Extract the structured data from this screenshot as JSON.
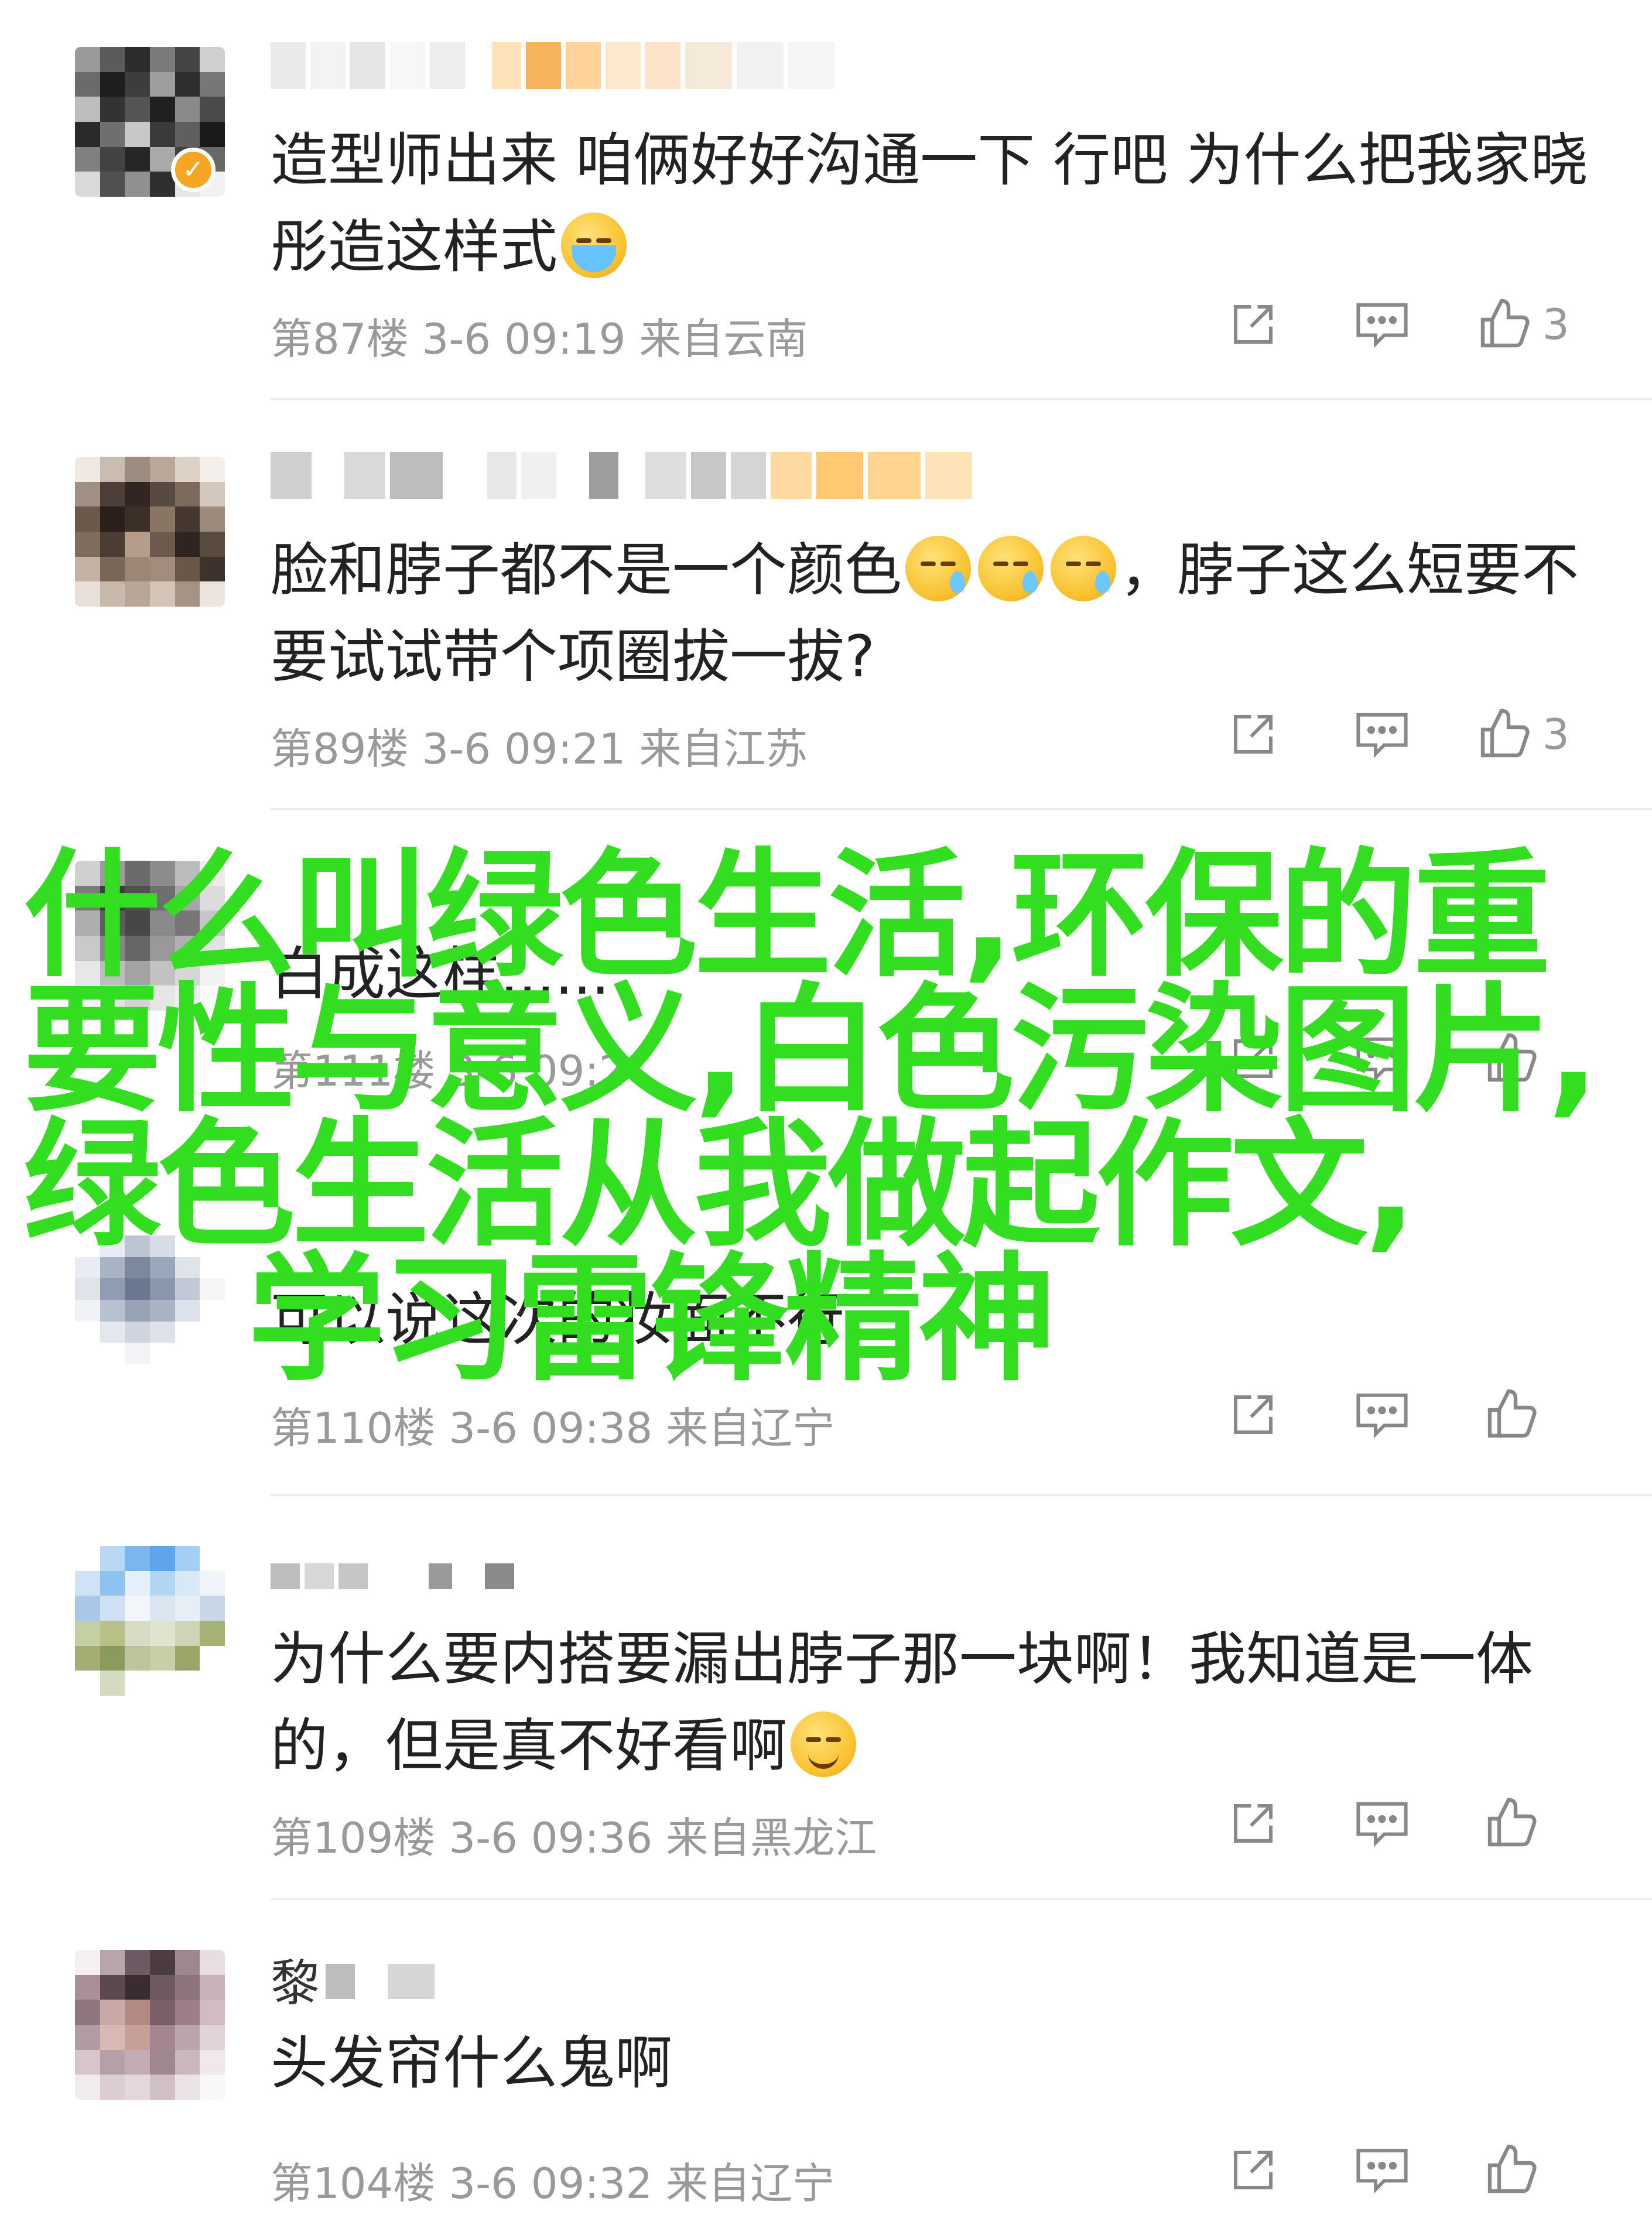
{
  "comments": [
    {
      "text_parts": [
        "造型师出来 咱俩好好沟通一下 行吧 为什么把我家晓彤造这样式"
      ],
      "emojis": [
        "cry"
      ],
      "meta": "第87楼 3-6 09:19 来自云南",
      "likes": "3",
      "verified": true
    },
    {
      "text_parts": [
        "脸和脖子都不是一个颜色",
        "，脖子这么短要不要试试带个项圈拔一拔?"
      ],
      "emojis": [
        "tear",
        "tear",
        "tear"
      ],
      "meta": "第89楼 3-6 09:21 来自江苏",
      "likes": "3"
    },
    {
      "name": "",
      "text_visible": "白成这样......",
      "meta": "第111楼 3-6 09:2",
      "likes": ""
    },
    {
      "text_visible": "可以说这次的妆面不行",
      "meta": "第110楼 3-6 09:38 来自辽宁",
      "likes": ""
    },
    {
      "text_parts": [
        "为什么要内搭要漏出脖子那一块啊！我知道是一体的，但是真不好看啊"
      ],
      "emojis": [
        "dizzy"
      ],
      "meta": "第109楼 3-6 09:36 来自黑龙江",
      "likes": ""
    },
    {
      "name": "黎",
      "text": "头发帘什么鬼啊",
      "meta": "第104楼 3-6 09:32 来自辽宁",
      "likes": ""
    }
  ],
  "overlay": {
    "line1": "什么叫绿色生活,环保的重要性与意义,白色污染图片,绿色生活从我做起作文,",
    "line2": "学习雷锋精神"
  },
  "icons": {
    "share": "share-edit-icon",
    "comment": "comment-bubble-icon",
    "like": "thumbs-up-icon"
  },
  "colors": {
    "overlay_green": "#33dd1f",
    "meta_gray": "#999999",
    "badge_orange": "#f5a623"
  }
}
